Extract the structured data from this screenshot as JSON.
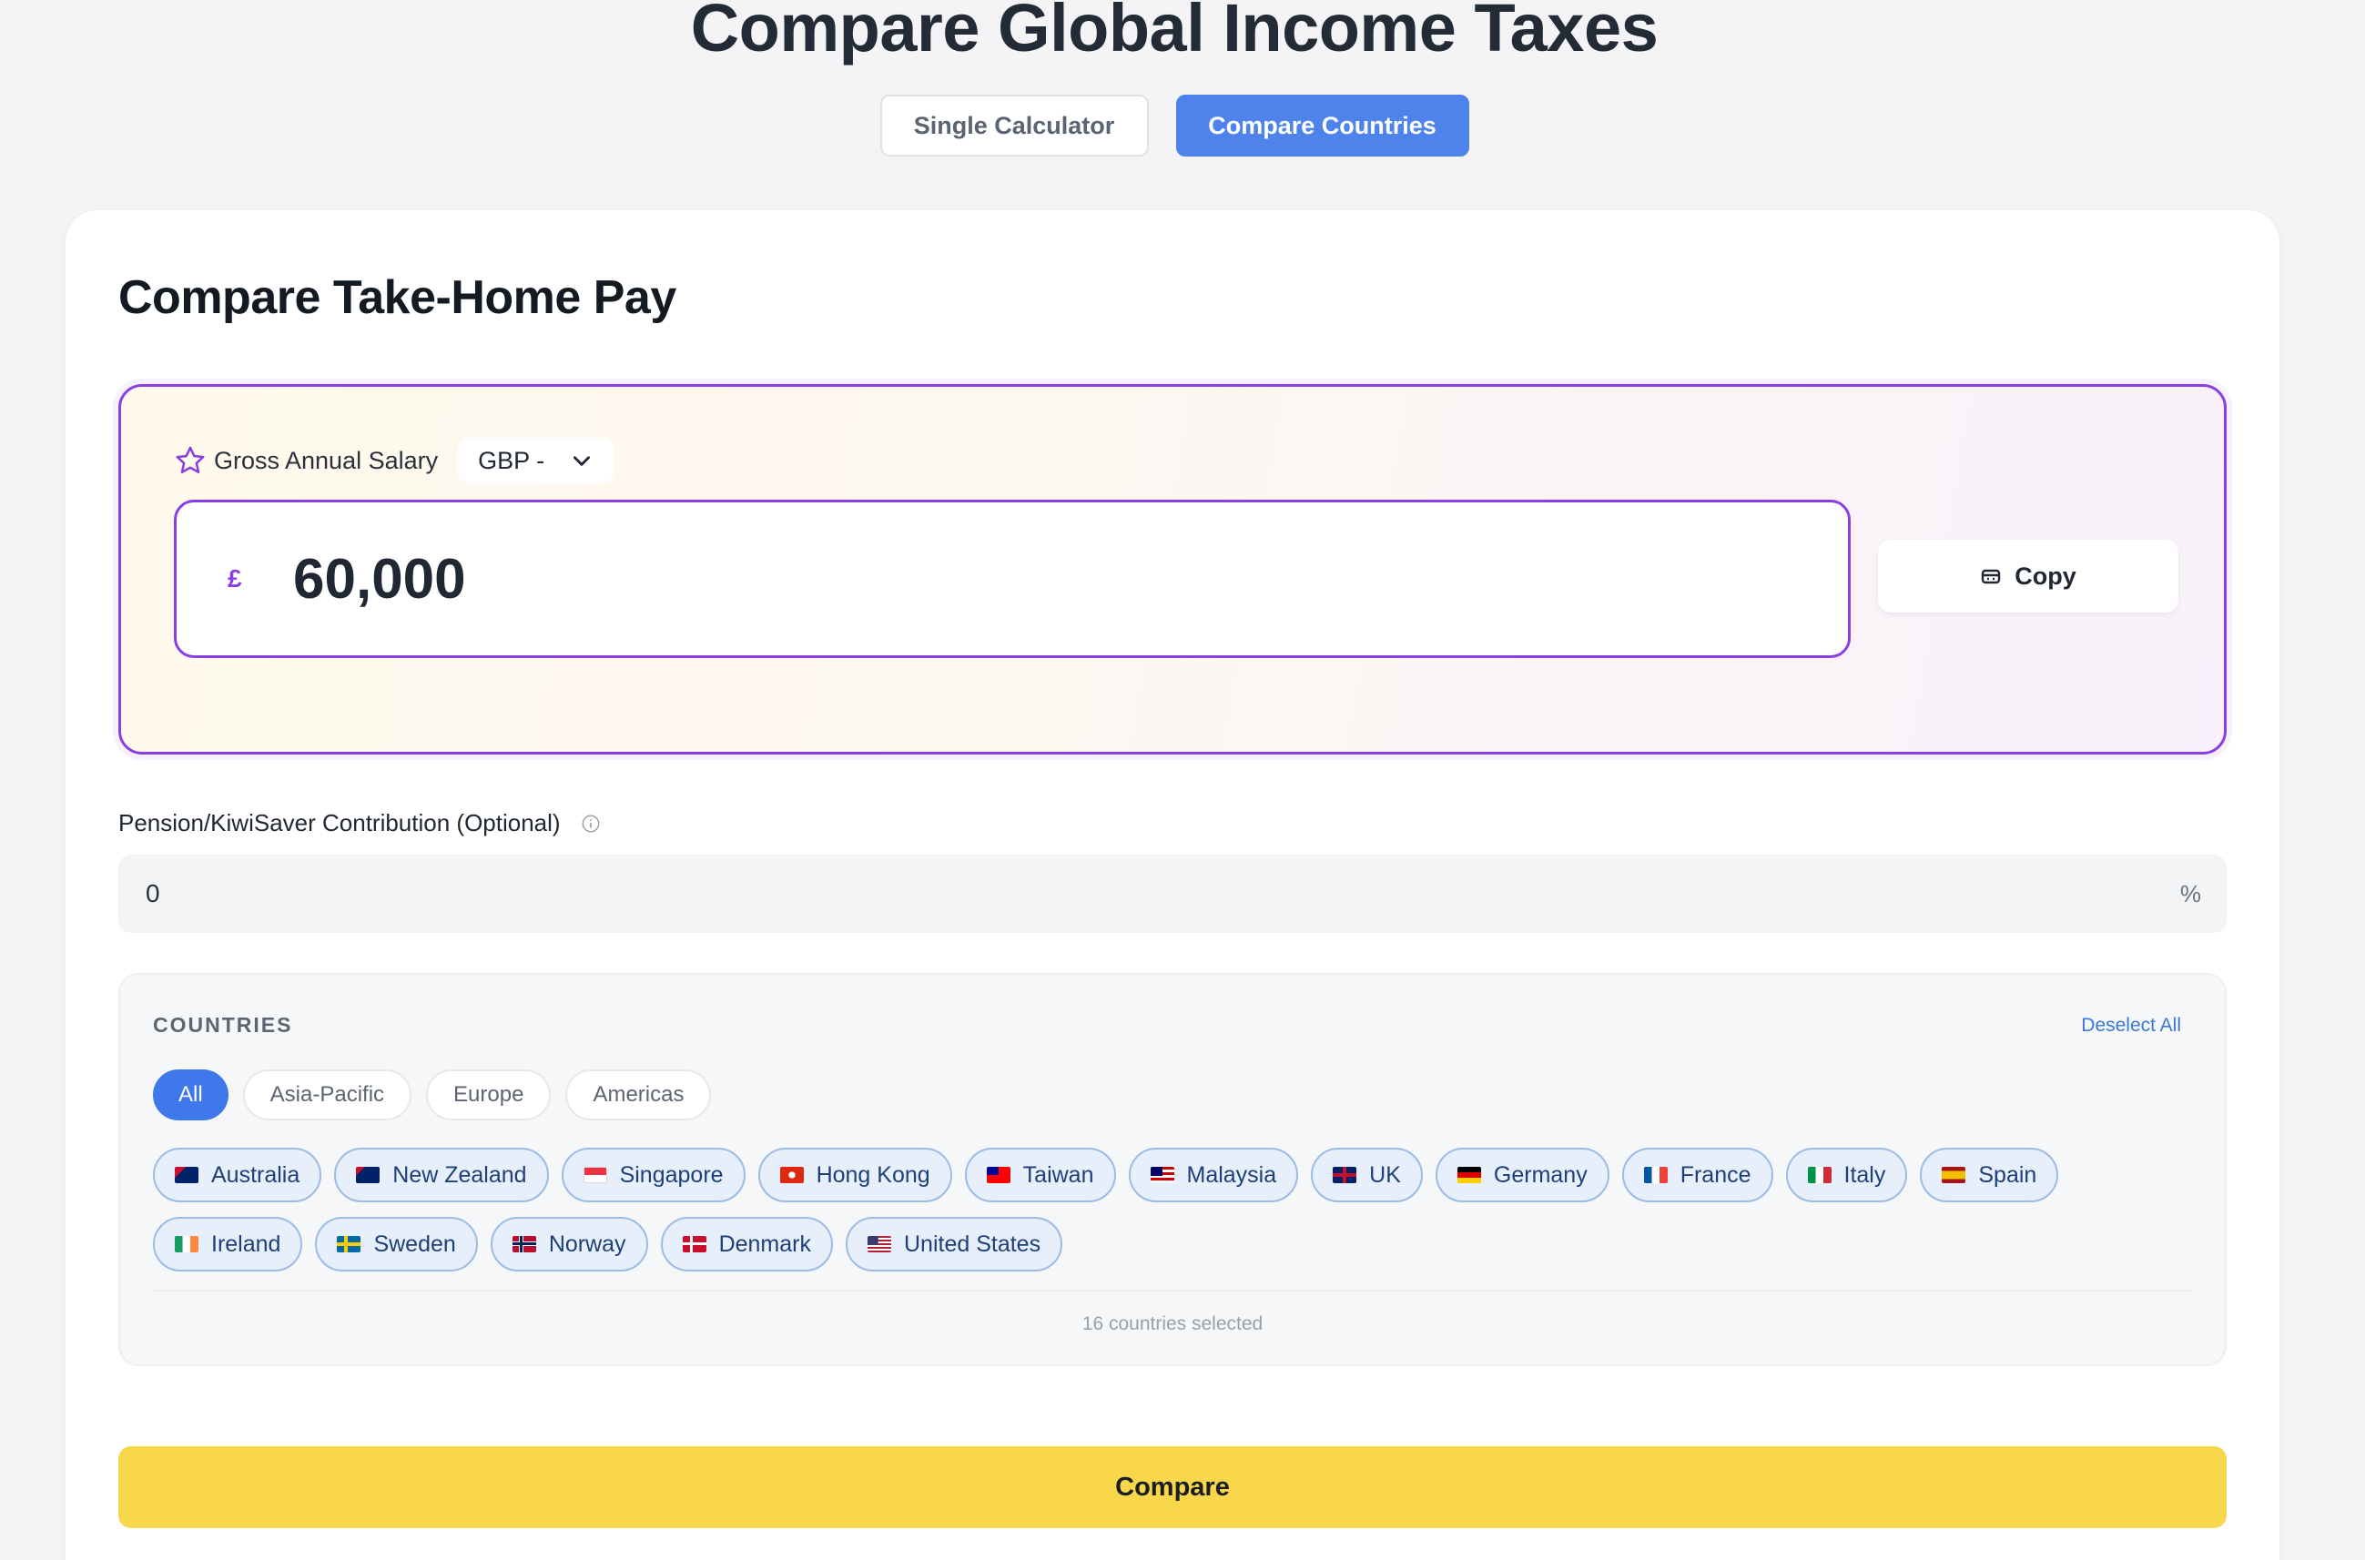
{
  "page": {
    "title": "Compare Global Income Taxes"
  },
  "mode_tabs": [
    {
      "label": "Single Calculator",
      "active": false
    },
    {
      "label": "Compare Countries",
      "active": true
    }
  ],
  "compare": {
    "title": "Compare Take-Home Pay",
    "salary": {
      "label": "Gross Annual Salary",
      "currency": "GBP -",
      "currency_symbol": "£",
      "value": "60,000",
      "copy_label": "Copy"
    },
    "pension": {
      "label": "Pension/KiwiSaver Contribution (Optional)",
      "value": "0",
      "unit": "%"
    },
    "countries": {
      "heading": "COUNTRIES",
      "deselect_label": "Deselect All",
      "regions": [
        {
          "label": "All",
          "selected": true
        },
        {
          "label": "Asia-Pacific",
          "selected": false
        },
        {
          "label": "Europe",
          "selected": false
        },
        {
          "label": "Americas",
          "selected": false
        }
      ],
      "list": [
        {
          "name": "Australia",
          "flag": "australia-flag-icon"
        },
        {
          "name": "New Zealand",
          "flag": "new-zealand-flag-icon"
        },
        {
          "name": "Singapore",
          "flag": "singapore-flag-icon"
        },
        {
          "name": "Hong Kong",
          "flag": "hong-kong-flag-icon"
        },
        {
          "name": "Taiwan",
          "flag": "taiwan-flag-icon"
        },
        {
          "name": "Malaysia",
          "flag": "malaysia-flag-icon"
        },
        {
          "name": "UK",
          "flag": "uk-flag-icon"
        },
        {
          "name": "Germany",
          "flag": "germany-flag-icon"
        },
        {
          "name": "France",
          "flag": "france-flag-icon"
        },
        {
          "name": "Italy",
          "flag": "italy-flag-icon"
        },
        {
          "name": "Spain",
          "flag": "spain-flag-icon"
        },
        {
          "name": "Ireland",
          "flag": "ireland-flag-icon"
        },
        {
          "name": "Sweden",
          "flag": "sweden-flag-icon"
        },
        {
          "name": "Norway",
          "flag": "norway-flag-icon"
        },
        {
          "name": "Denmark",
          "flag": "denmark-flag-icon"
        },
        {
          "name": "United States",
          "flag": "united-states-flag-icon"
        }
      ],
      "selected_count_text": "16 countries selected"
    },
    "submit_label": "Compare"
  },
  "colors": {
    "accent_blue": "#4f83ec",
    "accent_purple": "#8b3fe3",
    "compare_yellow": "#f8d74b",
    "chip_bg": "#e6effa"
  }
}
